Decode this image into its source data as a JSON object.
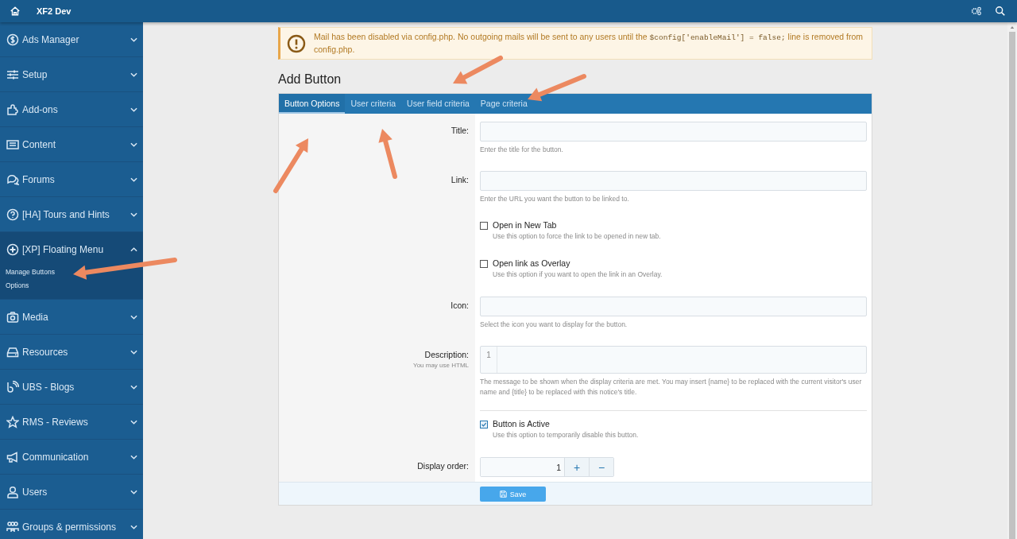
{
  "topbar": {
    "title": "XF2 Dev"
  },
  "sidebar": {
    "items": [
      {
        "label": "Ads Manager",
        "expanded": false
      },
      {
        "label": "Setup",
        "expanded": false
      },
      {
        "label": "Add-ons",
        "expanded": false
      },
      {
        "label": "Content",
        "expanded": false
      },
      {
        "label": "Forums",
        "expanded": false
      },
      {
        "label": "[HA] Tours and Hints",
        "expanded": false
      },
      {
        "label": "[XP] Floating Menu",
        "expanded": true,
        "children": [
          {
            "label": "Manage Buttons"
          },
          {
            "label": "Options"
          }
        ]
      },
      {
        "label": "Media",
        "expanded": false
      },
      {
        "label": "Resources",
        "expanded": false
      },
      {
        "label": "UBS - Blogs",
        "expanded": false
      },
      {
        "label": "RMS - Reviews",
        "expanded": false
      },
      {
        "label": "Communication",
        "expanded": false
      },
      {
        "label": "Users",
        "expanded": false
      },
      {
        "label": "Groups & permissions",
        "expanded": false
      }
    ]
  },
  "notice": {
    "text_before": "Mail has been disabled via config.php. No outgoing mails will be sent to any users until the ",
    "code": "$config['enableMail'] = false;",
    "text_after": " line is removed from config.php."
  },
  "page": {
    "title": "Add Button"
  },
  "tabs": [
    {
      "label": "Button Options",
      "selected": true
    },
    {
      "label": "User criteria",
      "selected": false
    },
    {
      "label": "User field criteria",
      "selected": false
    },
    {
      "label": "Page criteria",
      "selected": false
    }
  ],
  "form": {
    "rows": [
      {
        "kind": "text",
        "label": "Title:",
        "hint": "Enter the title for the button."
      },
      {
        "kind": "text",
        "label": "Link:",
        "hint": "Enter the URL you want the button to be linked to."
      },
      {
        "kind": "checkbox",
        "label": "Open in New Tab",
        "checked": false,
        "hint": "Use this option to force the link to be opened in new tab."
      },
      {
        "kind": "checkbox",
        "label": "Open link as Overlay",
        "checked": false,
        "hint": "Use this option if you want to open the link in an Overlay."
      },
      {
        "kind": "text",
        "label": "Icon:",
        "hint": "Select the icon you want to display for the button."
      },
      {
        "kind": "code",
        "label": "Description:",
        "sublabel": "You may use HTML",
        "line_number": "1",
        "hint": "The message to be shown when the display criteria are met. You may insert {name} to be replaced with the current visitor's user name and {title} to be replaced with this notice's title."
      },
      {
        "kind": "checkbox",
        "label": "Button is Active",
        "checked": true,
        "divider_before": true,
        "hint": "Use this option to temporarily disable this button."
      },
      {
        "kind": "number",
        "label": "Display order:",
        "value": "1",
        "plus": "+",
        "minus": "−"
      }
    ]
  },
  "submit": {
    "label": "Save"
  }
}
